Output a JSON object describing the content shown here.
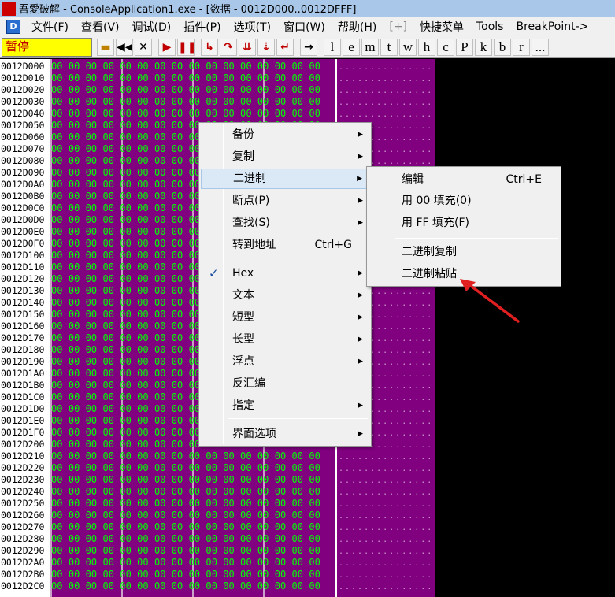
{
  "window": {
    "title": "吾愛破解 - ConsoleApplication1.exe - [数据 - 0012D000..0012DFFF]",
    "app_icon_text": "吾愛破解"
  },
  "menubar": {
    "items": [
      "文件(F)",
      "查看(V)",
      "调试(D)",
      "插件(P)",
      "选项(T)",
      "窗口(W)",
      "帮助(H)",
      "[+]",
      "快捷菜单",
      "Tools",
      "BreakPoint->"
    ]
  },
  "toolbar": {
    "status": "暂停",
    "letter_buttons": [
      "l",
      "e",
      "m",
      "t",
      "w",
      "h",
      "c",
      "P",
      "k",
      "b",
      "r",
      "..."
    ]
  },
  "dump": {
    "addresses": [
      "0012D000",
      "0012D010",
      "0012D020",
      "0012D030",
      "0012D040",
      "0012D050",
      "0012D060",
      "0012D070",
      "0012D080",
      "0012D090",
      "0012D0A0",
      "0012D0B0",
      "0012D0C0",
      "0012D0D0",
      "0012D0E0",
      "0012D0F0",
      "0012D100",
      "0012D110",
      "0012D120",
      "0012D130",
      "0012D140",
      "0012D150",
      "0012D160",
      "0012D170",
      "0012D180",
      "0012D190",
      "0012D1A0",
      "0012D1B0",
      "0012D1C0",
      "0012D1D0",
      "0012D1E0",
      "0012D1F0",
      "0012D200",
      "0012D210",
      "0012D220",
      "0012D230",
      "0012D240",
      "0012D250",
      "0012D260",
      "0012D270",
      "0012D280",
      "0012D290",
      "0012D2A0",
      "0012D2B0",
      "0012D2C0"
    ],
    "hex_row": "00 00 00 00 00 00 00 00 00 00 00 00 00 00 00 00",
    "ascii_row": "................"
  },
  "context_menu": {
    "items": [
      {
        "label": "备份",
        "submenu": true
      },
      {
        "label": "复制",
        "submenu": true
      },
      {
        "label": "二进制",
        "submenu": true,
        "highlighted": true
      },
      {
        "label": "断点(P)",
        "submenu": true
      },
      {
        "label": "查找(S)",
        "submenu": true
      },
      {
        "label": "转到地址",
        "shortcut": "Ctrl+G"
      },
      {
        "label": "Hex",
        "submenu": true,
        "checked": true
      },
      {
        "label": "文本",
        "submenu": true
      },
      {
        "label": "短型",
        "submenu": true
      },
      {
        "label": "长型",
        "submenu": true
      },
      {
        "label": "浮点",
        "submenu": true
      },
      {
        "label": "反汇编"
      },
      {
        "label": "指定",
        "submenu": true
      },
      {
        "label": "界面选项",
        "submenu": true
      }
    ],
    "check_mark": "✓",
    "submenu_arrow": "▶"
  },
  "binary_submenu": {
    "items": [
      {
        "label": "编辑",
        "shortcut": "Ctrl+E"
      },
      {
        "label": "用 00 填充(0)"
      },
      {
        "label": "用 FF 填充(F)"
      },
      {
        "label": "二进制复制"
      },
      {
        "label": "二进制粘贴"
      }
    ]
  },
  "colors": {
    "dump_bg": "#800080",
    "hex_text": "#00ff00",
    "status_bg": "#ffff00",
    "status_text": "#c00000",
    "annotation_arrow": "#e02020"
  }
}
